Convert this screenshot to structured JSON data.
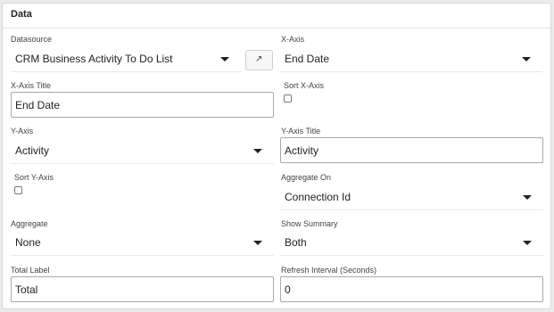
{
  "panel": {
    "title": "Data"
  },
  "datasource": {
    "label": "Datasource",
    "value": "CRM Business Activity To Do List",
    "open_icon": "external-link-icon"
  },
  "x_axis": {
    "label": "X-Axis",
    "value": "End Date"
  },
  "x_axis_title": {
    "label": "X-Axis Title",
    "value": "End Date"
  },
  "sort_x_axis": {
    "label": "Sort X-Axis",
    "checked": false
  },
  "y_axis": {
    "label": "Y-Axis",
    "value": "Activity"
  },
  "y_axis_title": {
    "label": "Y-Axis Title",
    "value": "Activity"
  },
  "sort_y_axis": {
    "label": "Sort Y-Axis",
    "checked": false
  },
  "aggregate_on": {
    "label": "Aggregate On",
    "value": "Connection Id"
  },
  "aggregate": {
    "label": "Aggregate",
    "value": "None"
  },
  "show_summary": {
    "label": "Show Summary",
    "value": "Both"
  },
  "total_label": {
    "label": "Total Label",
    "value": "Total"
  },
  "refresh_interval": {
    "label": "Refresh Interval (Seconds)",
    "value": "0"
  }
}
